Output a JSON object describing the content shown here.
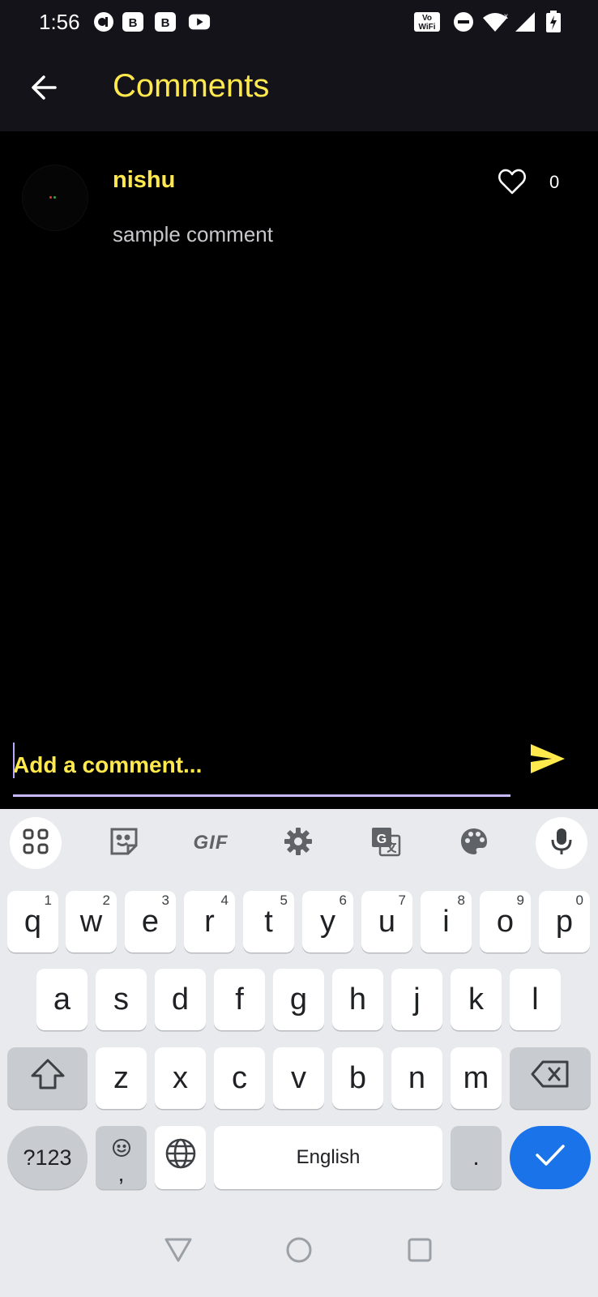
{
  "status_bar": {
    "time": "1:56",
    "icons": [
      "notification-app-icon",
      "b-badge-icon",
      "b-badge-icon",
      "youtube-icon",
      "vowifi-icon",
      "dnd-icon",
      "wifi-icon",
      "signal-icon",
      "battery-charging-icon"
    ],
    "vowifi_top": "Vo",
    "vowifi_bottom": "WiFi"
  },
  "header": {
    "title": "Comments",
    "back_icon": "arrow-left-icon"
  },
  "comments": [
    {
      "username": "nishu",
      "text": "sample comment",
      "likes": "0",
      "like_icon": "heart-outline-icon"
    }
  ],
  "composer": {
    "placeholder": "Add a comment...",
    "send_icon": "send-icon"
  },
  "keyboard": {
    "toolbar": [
      "apps-grid-icon",
      "sticker-icon",
      "gif-icon",
      "settings-icon",
      "translate-icon",
      "palette-icon",
      "mic-icon"
    ],
    "gif_label": "GIF",
    "row1": [
      {
        "key": "q",
        "hint": "1"
      },
      {
        "key": "w",
        "hint": "2"
      },
      {
        "key": "e",
        "hint": "3"
      },
      {
        "key": "r",
        "hint": "4"
      },
      {
        "key": "t",
        "hint": "5"
      },
      {
        "key": "y",
        "hint": "6"
      },
      {
        "key": "u",
        "hint": "7"
      },
      {
        "key": "i",
        "hint": "8"
      },
      {
        "key": "o",
        "hint": "9"
      },
      {
        "key": "p",
        "hint": "0"
      }
    ],
    "row2": [
      "a",
      "s",
      "d",
      "f",
      "g",
      "h",
      "j",
      "k",
      "l"
    ],
    "row3": [
      "z",
      "x",
      "c",
      "v",
      "b",
      "n",
      "m"
    ],
    "symbols_label": "?123",
    "comma_label": ",",
    "space_label": "English",
    "period_label": ".",
    "colors": {
      "enter": "#1a73e8",
      "background": "#e8eaed"
    }
  },
  "navigation": [
    "back-triangle-icon",
    "home-circle-icon",
    "recents-square-icon"
  ],
  "colors": {
    "accent": "#ffe94d",
    "app_bar": "#15131a",
    "background": "#000000",
    "underline": "#c8b8ff"
  }
}
